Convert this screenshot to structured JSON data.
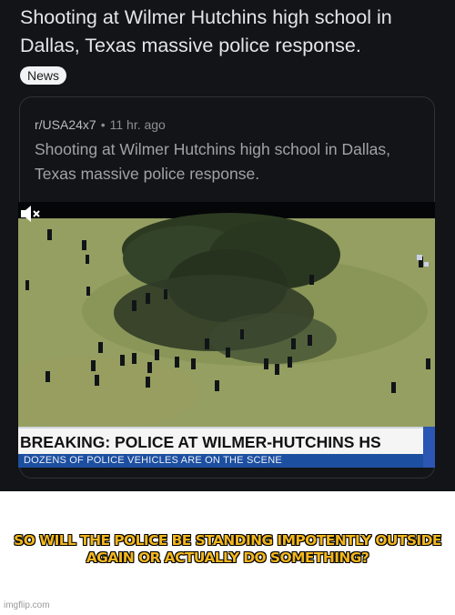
{
  "post": {
    "title": "Shooting at Wilmer Hutchins high school in Dallas, Texas massive police response.",
    "flair": "News"
  },
  "crosspost": {
    "subreddit": "r/USA24x7",
    "separator": "•",
    "age": "11 hr. ago",
    "title": "Shooting at Wilmer Hutchins high school in Dallas, Texas massive police response."
  },
  "video": {
    "headline": "BREAKING: POLICE AT WILMER-HUTCHINS HS",
    "subline": "DOZENS OF POLICE VEHICLES ARE ON THE SCENE",
    "mute_icon": "speaker-muted-icon"
  },
  "meme": {
    "caption_line1": "SO WILL THE POLICE BE STANDING IMPOTENTLY OUTSIDE",
    "caption_line2": "AGAIN OR ACTUALLY DO SOMETHING?",
    "caption_color": "#f2b71e"
  },
  "watermark": "imgflip.com",
  "colors": {
    "background_dark": "#121417",
    "headline_bar": "#f5f5f5",
    "subline_bar": "#1d4fa0"
  }
}
